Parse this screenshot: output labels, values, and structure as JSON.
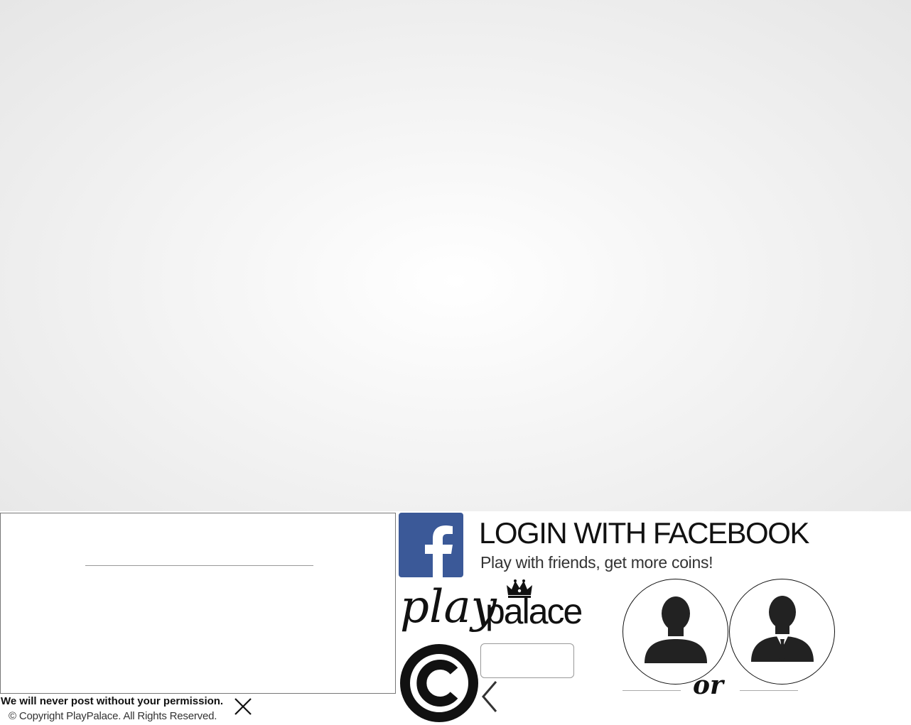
{
  "facebook": {
    "title": "LOGIN WITH FACEBOOK",
    "subtitle": "Play with friends, get more coins!",
    "brand_color": "#3b5998"
  },
  "logo": {
    "script_part": "play",
    "sans_part": "palace"
  },
  "notice": "We will never post without your permission.",
  "copyright": "© Copyright PlayPalace. All Rights Reserved.",
  "divider": "or",
  "icons": {
    "facebook": "facebook-icon",
    "close": "close-icon",
    "back": "chevron-left-icon",
    "copyright": "copyright-icon",
    "crown": "crown-icon",
    "avatar_casual": "user-avatar-icon",
    "avatar_suit": "user-suit-avatar-icon"
  }
}
